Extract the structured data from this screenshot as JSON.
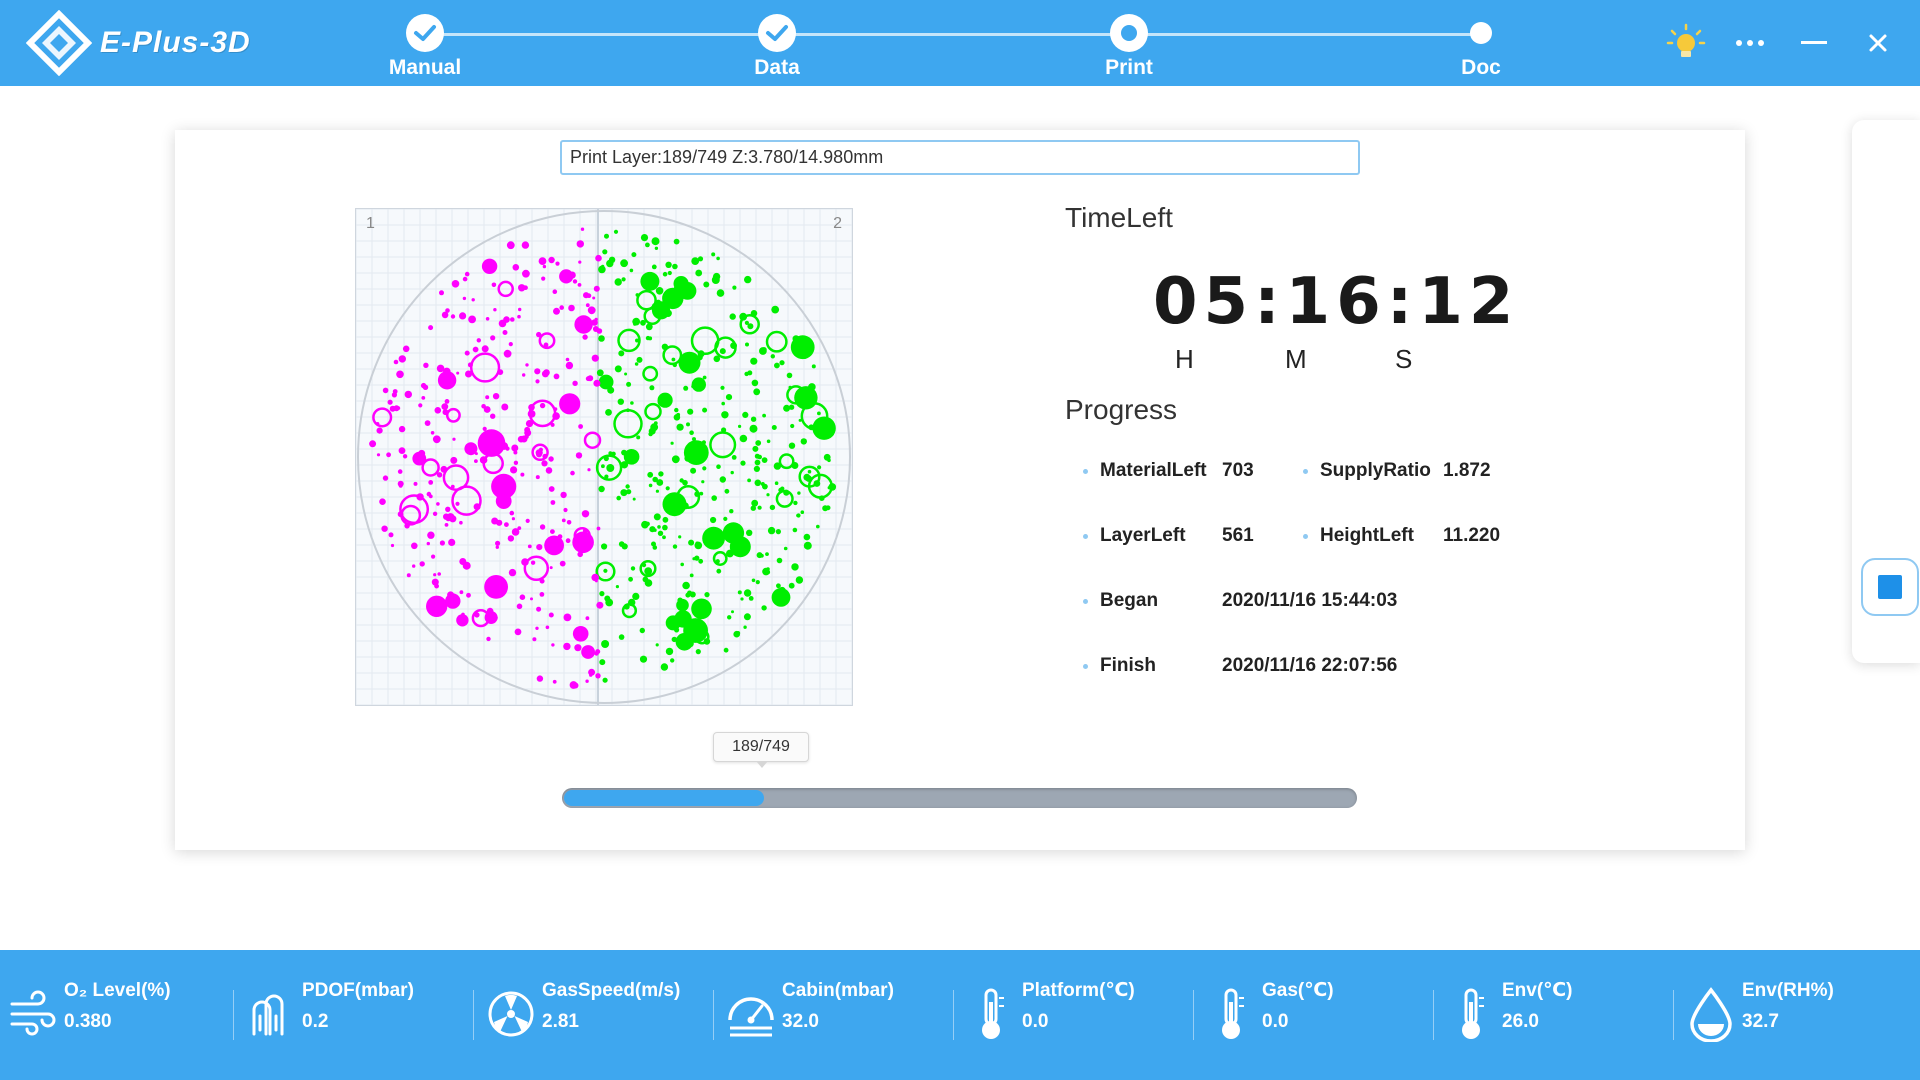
{
  "app": {
    "logo_text": "E-Plus-3D"
  },
  "steps": [
    {
      "label": "Manual",
      "state": "done"
    },
    {
      "label": "Data",
      "state": "done"
    },
    {
      "label": "Print",
      "state": "current"
    },
    {
      "label": "Doc",
      "state": "pending"
    }
  ],
  "window_controls": {
    "icons": [
      "light-bulb-icon",
      "more-icon",
      "minimize-icon",
      "close-icon"
    ]
  },
  "print": {
    "layer_info": "Print Layer:189/749 Z:3.780/14.980mm",
    "preview_labels": [
      "1",
      "2"
    ],
    "preview_colors": {
      "part1": "#ff00ff",
      "part2": "#00ee00"
    }
  },
  "timeleft": {
    "title": "TimeLeft",
    "value": "05:16:12",
    "units": [
      "H",
      "M",
      "S"
    ]
  },
  "progress": {
    "title": "Progress",
    "stats": [
      {
        "label": "MaterialLeft",
        "value": "703"
      },
      {
        "label": "SupplyRatio",
        "value": "1.872"
      },
      {
        "label": "LayerLeft",
        "value": "561"
      },
      {
        "label": "HeightLeft",
        "value": "11.220"
      },
      {
        "label": "Began",
        "value": "2020/11/16 15:44:03"
      },
      {
        "label": "Finish",
        "value": "2020/11/16 22:07:56"
      }
    ]
  },
  "slider": {
    "label": "189/749",
    "current": 189,
    "total": 749
  },
  "sensors": [
    {
      "label": "O₂ Level(%)",
      "value": "0.380",
      "icon": "wind-icon"
    },
    {
      "label": "PDOF(mbar)",
      "value": "0.2",
      "icon": "pressure-icon"
    },
    {
      "label": "GasSpeed(m/s)",
      "value": "2.81",
      "icon": "fan-icon"
    },
    {
      "label": "Cabin(mbar)",
      "value": "32.0",
      "icon": "gauge-icon"
    },
    {
      "label": "Platform(℃)",
      "value": "0.0",
      "icon": "thermometer-icon"
    },
    {
      "label": "Gas(℃)",
      "value": "0.0",
      "icon": "thermometer-icon"
    },
    {
      "label": "Env(℃)",
      "value": "26.0",
      "icon": "thermometer-icon"
    },
    {
      "label": "Env(RH%)",
      "value": "32.7",
      "icon": "droplet-icon"
    }
  ],
  "colors": {
    "accent": "#3ea7ef",
    "stop": "#1e90e8"
  }
}
